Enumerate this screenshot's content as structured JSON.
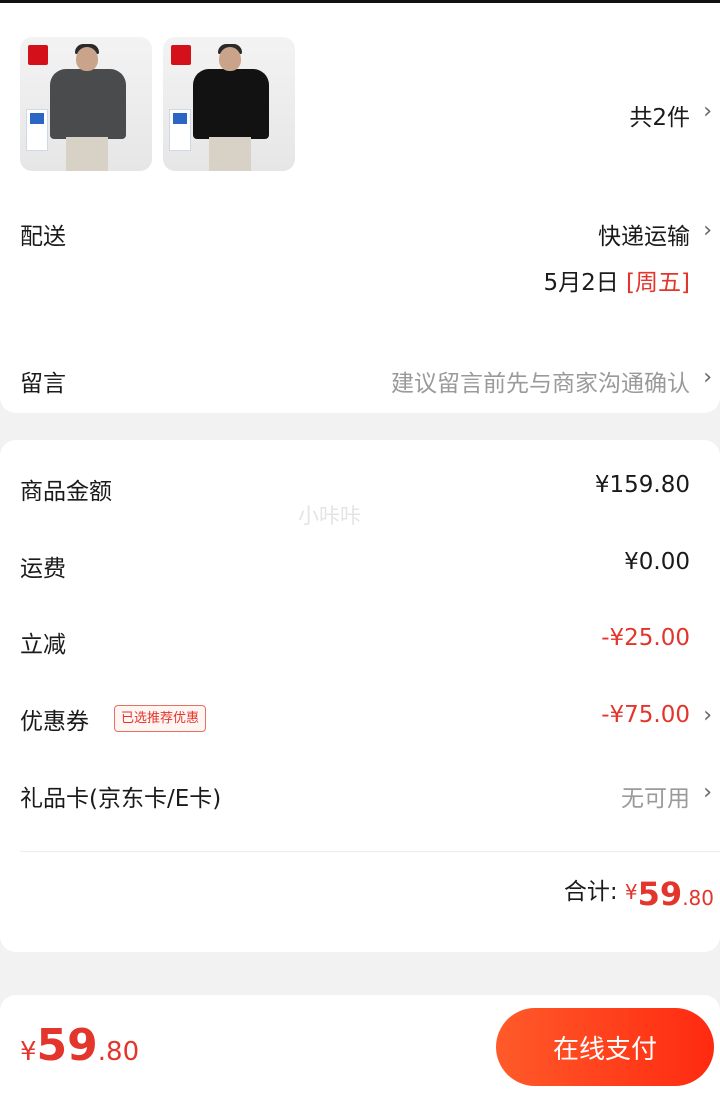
{
  "items": {
    "count_text": "共2件",
    "thumbnails": [
      {
        "shirt_color": "#4a4b4d"
      },
      {
        "shirt_color": "#121212"
      }
    ]
  },
  "delivery": {
    "label": "配送",
    "method": "快递运输",
    "date": "5月2日",
    "weekday": "[周五]"
  },
  "message": {
    "label": "留言",
    "placeholder": "建议留言前先与商家沟通确认"
  },
  "price": {
    "goods_label": "商品金额",
    "goods_value": "¥159.80",
    "shipping_label": "运费",
    "shipping_value": "¥0.00",
    "discount_label": "立减",
    "discount_value": "-¥25.00",
    "coupon_label": "优惠券",
    "coupon_tag": "已选推荐优惠",
    "coupon_value": "-¥75.00",
    "giftcard_label": "礼品卡(京东卡/E卡)",
    "giftcard_value": "无可用",
    "total_label": "合计:",
    "total_currency": "¥",
    "total_int": "59",
    "total_dec": ".80"
  },
  "watermark": "小咔咔",
  "footer": {
    "currency": "¥",
    "amount_int": "59",
    "amount_dec": ".80",
    "pay_label": "在线支付"
  },
  "colors": {
    "accent": "#e3352b",
    "pay_button_start": "#ff5a2a",
    "pay_button_end": "#ff2a10"
  }
}
